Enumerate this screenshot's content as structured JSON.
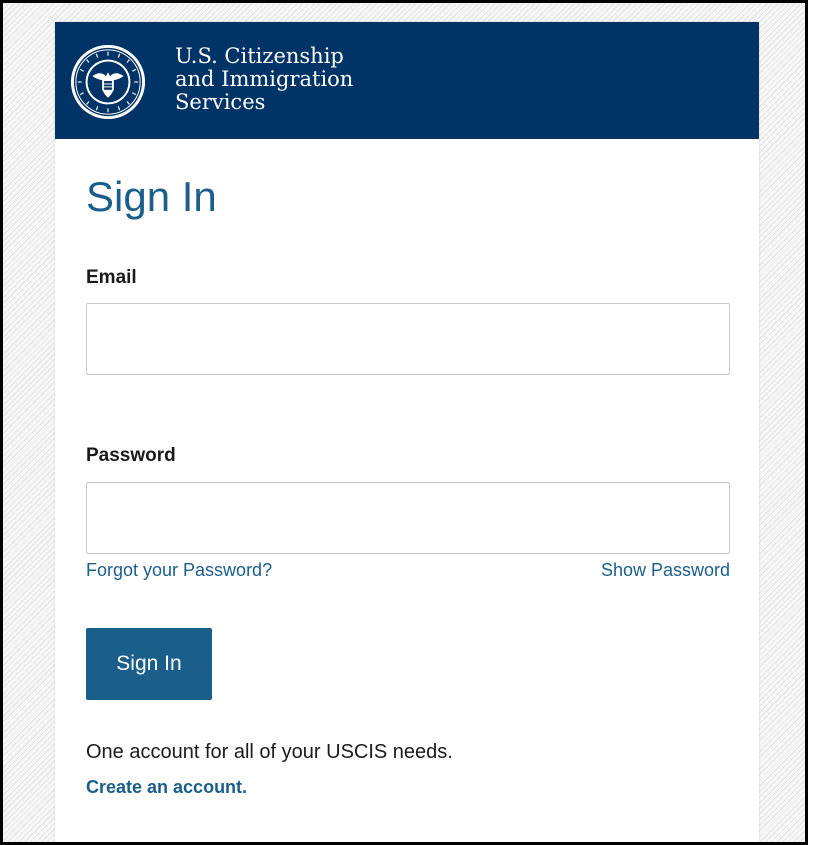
{
  "header": {
    "agency_name_lines": [
      "U.S. Citizenship",
      "and Immigration",
      "Services"
    ],
    "seal_icon": "dhs-seal-icon",
    "background_color": "#003366"
  },
  "form": {
    "title": "Sign In",
    "email_label": "Email",
    "email_value": "",
    "password_label": "Password",
    "password_value": "",
    "forgot_password_link": "Forgot your Password?",
    "show_password_link": "Show Password",
    "submit_label": "Sign In"
  },
  "footer": {
    "promo_text": "One account for all of your USCIS needs.",
    "create_account_link": "Create an account."
  },
  "colors": {
    "accent": "#1a5e8a",
    "text": "#1b1b1b",
    "header_bg": "#003366"
  }
}
